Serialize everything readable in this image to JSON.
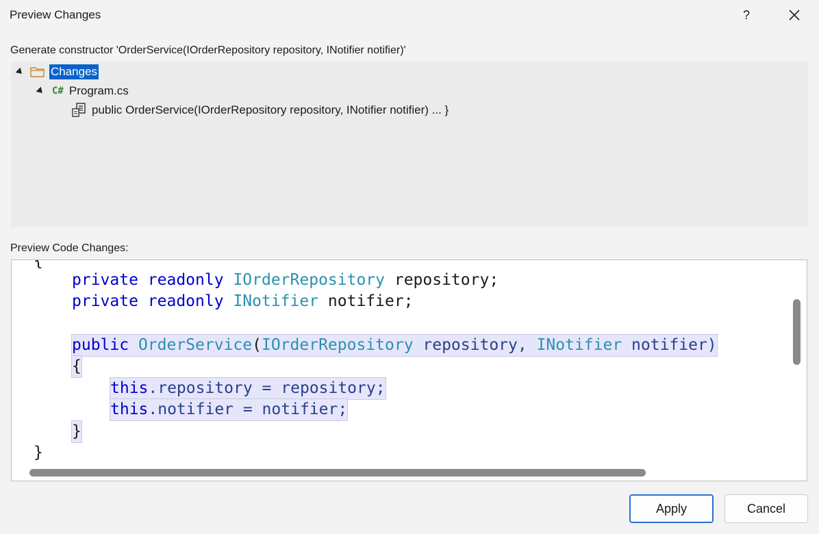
{
  "window": {
    "title": "Preview Changes",
    "help_label": "?"
  },
  "description": "Generate constructor 'OrderService(IOrderRepository repository, INotifier notifier)'",
  "tree": {
    "root_label": "Changes",
    "file_label": "Program.cs",
    "file_icon_text": "C#",
    "member_label": "public OrderService(IOrderRepository repository, INotifier notifier) ... }"
  },
  "preview_label": "Preview Code Changes:",
  "code": {
    "l0": "{",
    "l1_kw1": "private",
    "l1_kw2": "readonly",
    "l1_type": "IOrderRepository",
    "l1_rest": " repository;",
    "l2_kw1": "private",
    "l2_kw2": "readonly",
    "l2_type": "INotifier",
    "l2_rest": " notifier;",
    "l4_kw": "public",
    "l4_name": "OrderService",
    "l4_p1": "(",
    "l4_t1": "IOrderRepository",
    "l4_a1": " repository, ",
    "l4_t2": "INotifier",
    "l4_a2": " notifier)",
    "l5": "{",
    "l6_kw": "this",
    "l6_rest": ".repository = repository;",
    "l7_kw": "this",
    "l7_rest": ".notifier = notifier;",
    "l8": "}",
    "l9": "}"
  },
  "buttons": {
    "apply": "Apply",
    "cancel": "Cancel"
  },
  "colors": {
    "selection": "#0a63c9",
    "keyword": "#0000cc",
    "type": "#2b91af",
    "highlight": "#e6e6fb"
  }
}
